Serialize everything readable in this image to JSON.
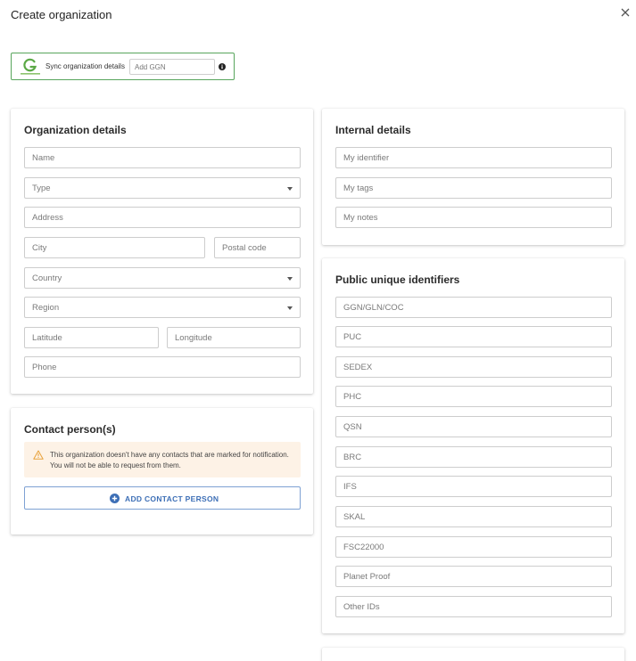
{
  "dialog": {
    "title": "Create organization",
    "close_icon": "close-icon"
  },
  "sync": {
    "logo_icon": "globalg-ap-logo",
    "label": "Sync organization details",
    "ggn_placeholder": "Add GGN",
    "info_icon": "info-icon"
  },
  "organization_details": {
    "title": "Organization details",
    "name_placeholder": "Name",
    "type_placeholder": "Type",
    "address_placeholder": "Address",
    "city_placeholder": "City",
    "postal_code_placeholder": "Postal code",
    "country_placeholder": "Country",
    "region_placeholder": "Region",
    "latitude_placeholder": "Latitude",
    "longitude_placeholder": "Longitude",
    "phone_placeholder": "Phone"
  },
  "contact_persons": {
    "title": "Contact person(s)",
    "alert_text": "This organization doesn't have any contacts that are marked for notification. You will not be able to request from them.",
    "alert_icon": "warning-icon",
    "add_button_label": "ADD CONTACT PERSON",
    "add_button_icon": "plus-circle-icon"
  },
  "internal_details": {
    "title": "Internal details",
    "identifier_placeholder": "My identifier",
    "tags_placeholder": "My tags",
    "notes_placeholder": "My notes"
  },
  "public_identifiers": {
    "title": "Public unique identifiers",
    "fields": [
      "GGN/GLN/COC",
      "PUC",
      "SEDEX",
      "PHC",
      "QSN",
      "BRC",
      "IFS",
      "SKAL",
      "FSC22000",
      "Planet Proof",
      "Other IDs"
    ]
  },
  "colors": {
    "sync_border": "#58a55c",
    "accent_blue": "#3d6fb6",
    "alert_bg": "#fdf2e6",
    "warning": "#e8a13a"
  }
}
